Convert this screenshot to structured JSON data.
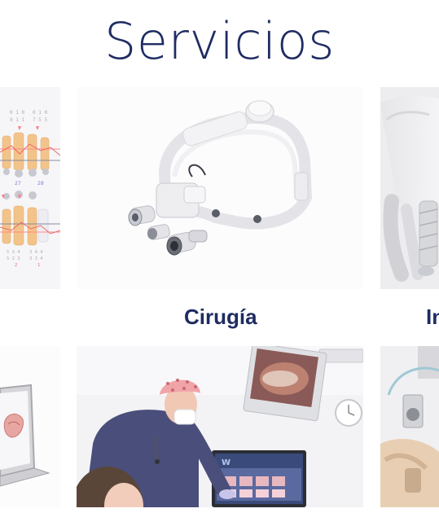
{
  "page": {
    "title": "Servicios"
  },
  "services": [
    {
      "label": "",
      "icon": "periodontogram-chart"
    },
    {
      "label": "Cirugía",
      "icon": "surgical-loupes-headlight"
    },
    {
      "label": "In",
      "icon": "dental-implant-tooth"
    },
    {
      "label": "",
      "icon": "laptop-digital-scan"
    },
    {
      "label": "",
      "icon": "dentist-at-monitor-photo"
    },
    {
      "label": "",
      "icon": "dental-chair-equipment"
    }
  ],
  "colors": {
    "title": "#1f2c63",
    "label": "#1f2c63",
    "background": "#ffffff"
  }
}
